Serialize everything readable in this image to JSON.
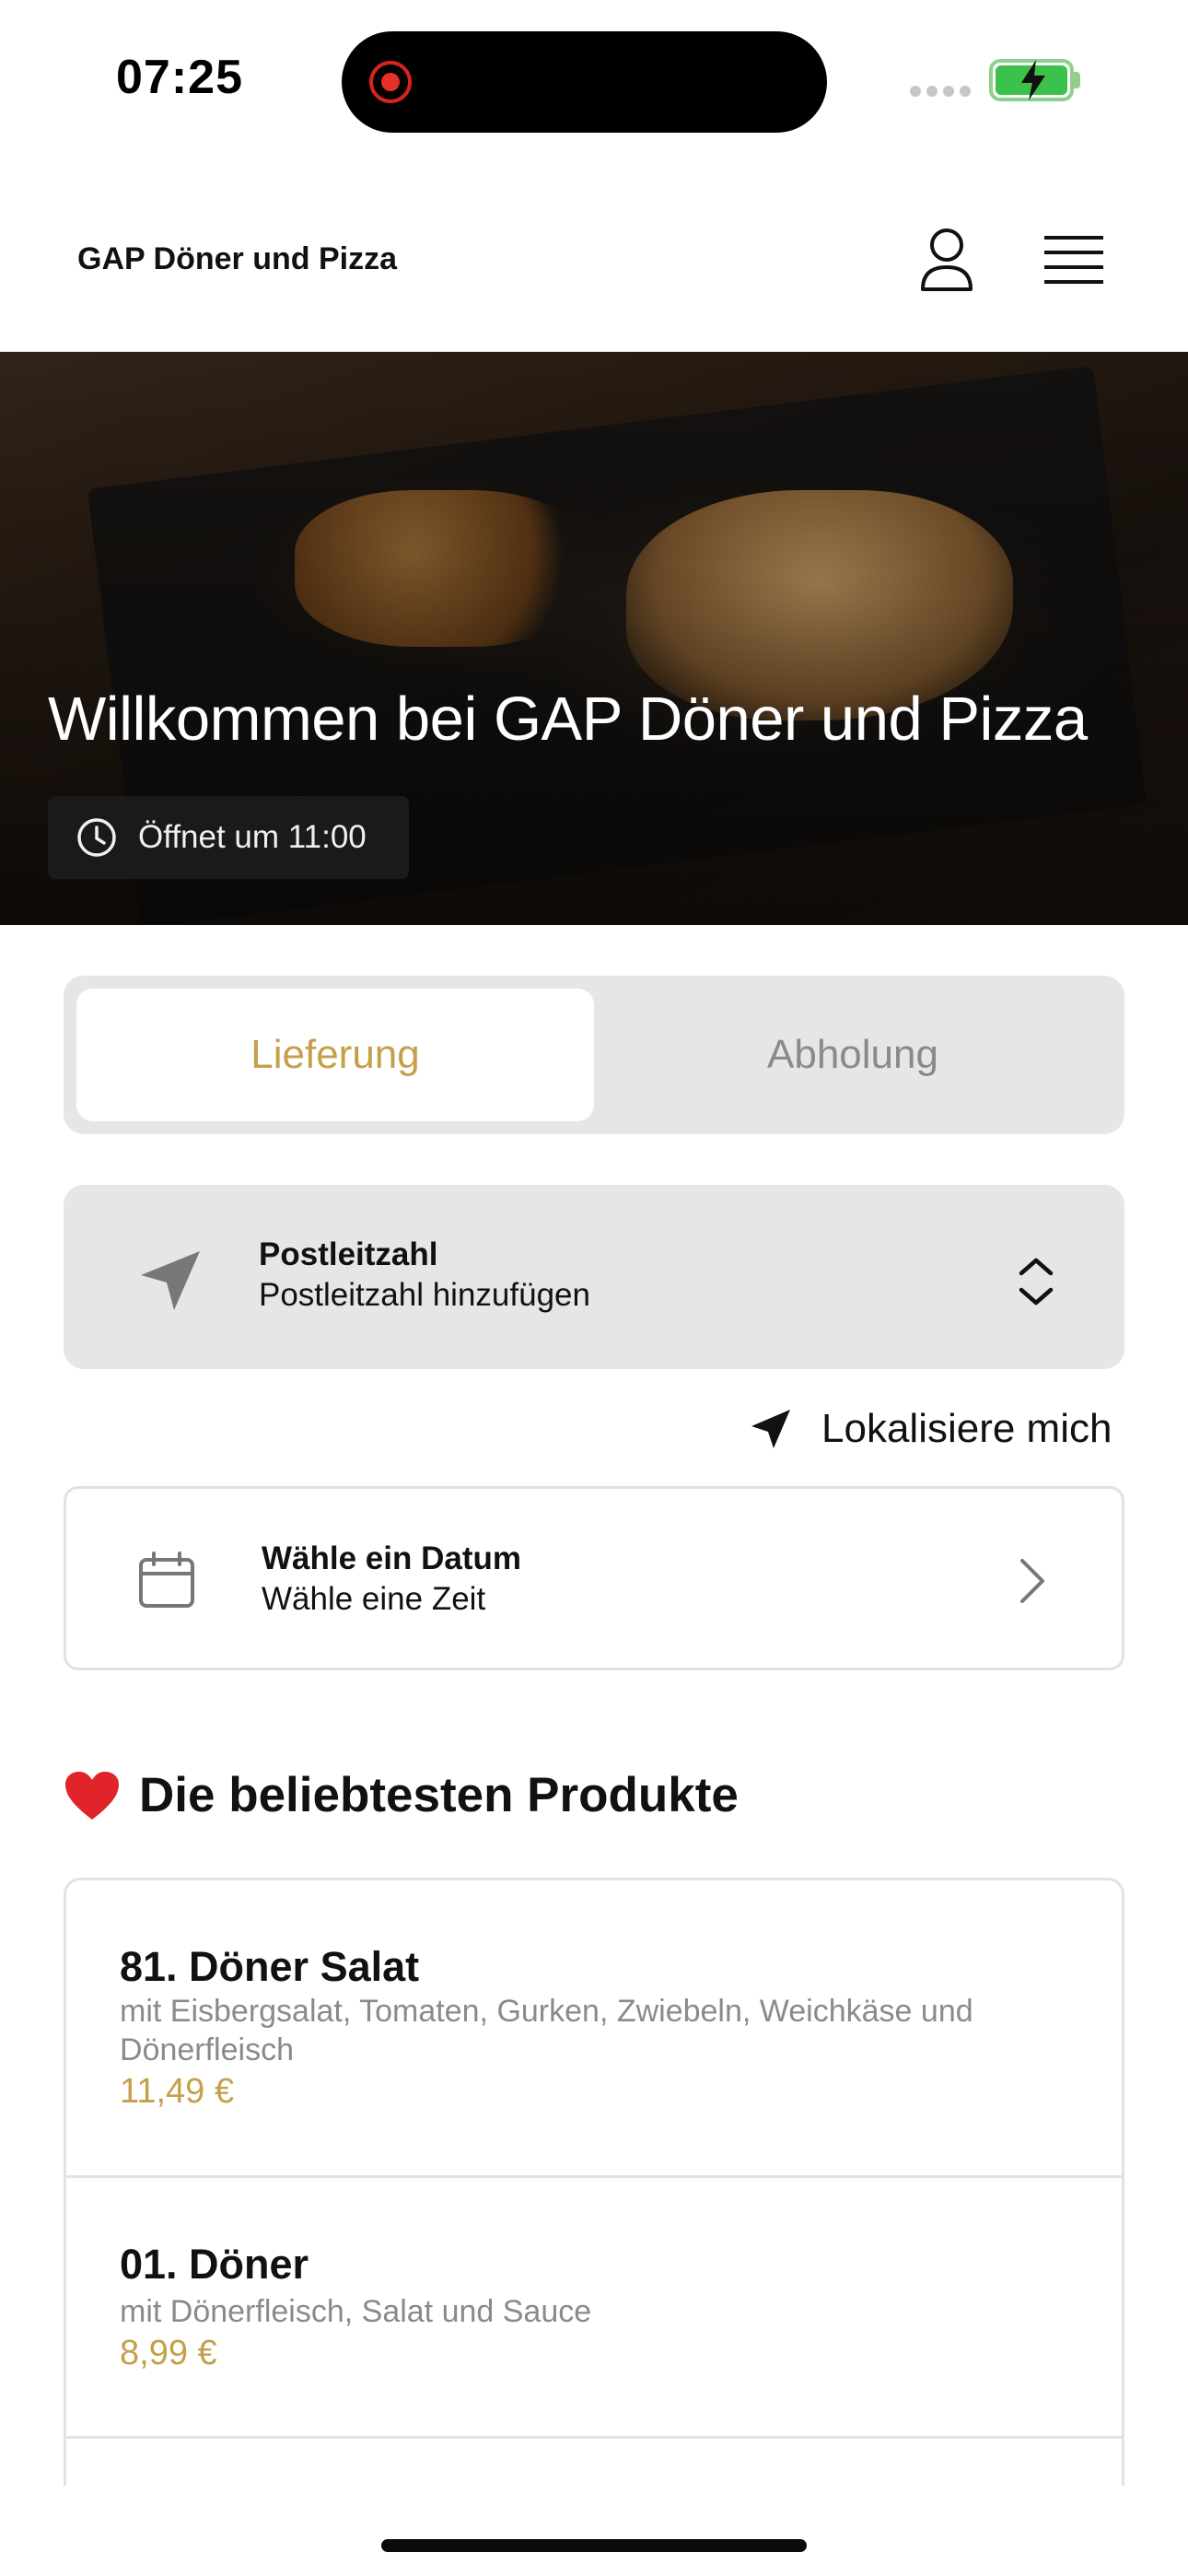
{
  "status_bar": {
    "time": "07:25"
  },
  "header": {
    "brand": "GAP Döner und Pizza"
  },
  "hero": {
    "title": "Willkommen bei GAP Döner und Pizza",
    "hours": "Öffnet um 11:00"
  },
  "order_type": {
    "options": [
      "Lieferung",
      "Abholung"
    ],
    "selected": "Lieferung"
  },
  "postcode": {
    "label": "Postleitzahl",
    "placeholder": "Postleitzahl hinzufügen"
  },
  "locate": {
    "label": "Lokalisiere mich"
  },
  "date": {
    "label": "Wähle ein Datum",
    "value": "Wähle eine Zeit"
  },
  "popular": {
    "title": "Die beliebtesten Produkte",
    "items": [
      {
        "name": "81. Döner Salat",
        "description": "mit Eisbergsalat, Tomaten, Gurken, Zwiebeln, Weichkäse und Dönerfleisch",
        "price": "11,49 €"
      },
      {
        "name": "01. Döner",
        "description": "mit Dönerfleisch, Salat und Sauce",
        "price": "8,99 €"
      }
    ]
  },
  "colors": {
    "accent": "#c5a04a",
    "panel": "#e6e6e6",
    "heart": "#e0242a",
    "battery": "#3cc14a"
  },
  "icons": [
    "user-icon",
    "menu-icon",
    "clock-icon",
    "location-arrow-icon",
    "up-down-chevron-icon",
    "calendar-icon",
    "chevron-right-icon",
    "heart-icon"
  ]
}
